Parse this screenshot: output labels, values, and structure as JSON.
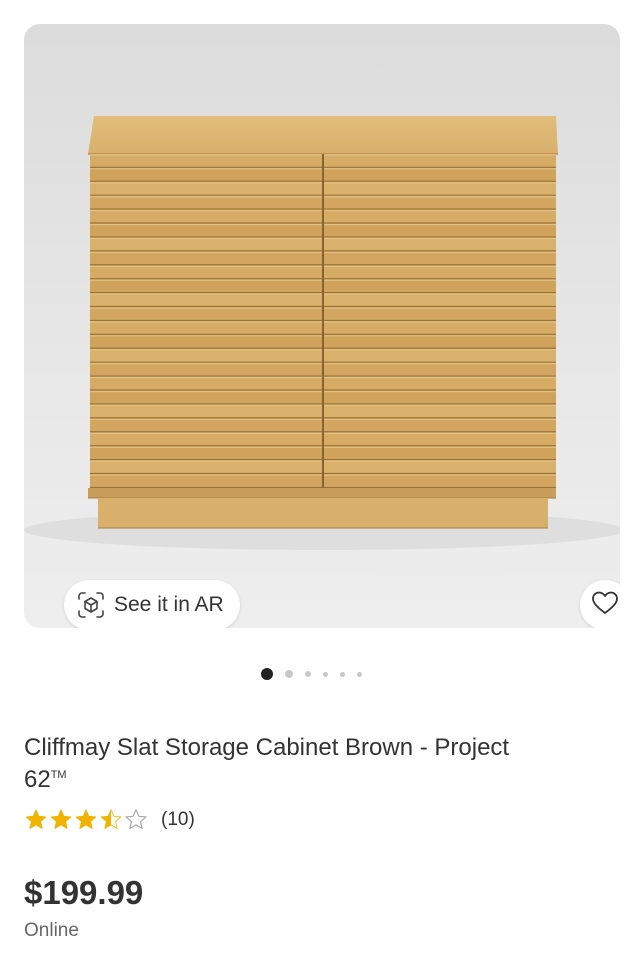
{
  "product": {
    "title": "Cliffmay Slat Storage Cabinet Brown - Project 62",
    "trademark": "TM",
    "price": "$199.99",
    "availability": "Online",
    "rating": {
      "value": 3.5,
      "max": 5,
      "count_label": "(10)"
    }
  },
  "media": {
    "ar_button_label": "See it in AR",
    "ar_icon": "ar-cube-icon",
    "favorite_icon": "heart-outline-icon",
    "carousel": {
      "total": 6,
      "active_index": 0
    }
  },
  "colors": {
    "star": "#f0b400",
    "wood": "#d4a862"
  }
}
